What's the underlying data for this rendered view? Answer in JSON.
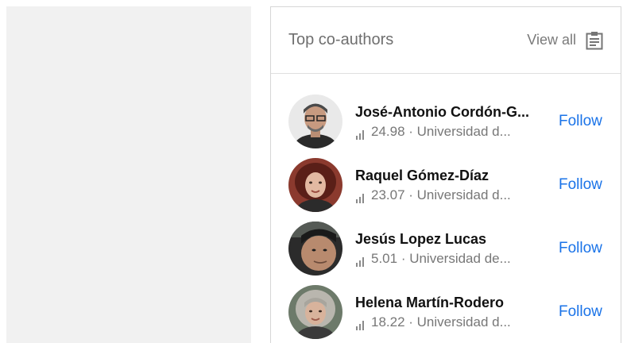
{
  "card": {
    "title": "Top co-authors",
    "view_all_label": "View all",
    "view_all_icon": "clipboard-list-icon"
  },
  "coauthors": [
    {
      "name": "José-Antonio Cordón-G...",
      "score": "24.98",
      "affiliation": "Universidad d...",
      "follow_label": "Follow"
    },
    {
      "name": "Raquel Gómez-Díaz",
      "score": "23.07",
      "affiliation": "Universidad d...",
      "follow_label": "Follow"
    },
    {
      "name": "Jesús Lopez Lucas",
      "score": "5.01",
      "affiliation": "Universidad de...",
      "follow_label": "Follow"
    },
    {
      "name": "Helena Martín-Rodero",
      "score": "18.22",
      "affiliation": "Universidad d...",
      "follow_label": "Follow"
    }
  ],
  "colors": {
    "accent": "#1a73e8",
    "title_text": "#6f6f6f",
    "meta_text": "#777777",
    "left_panel_bg": "#f1f1f1"
  }
}
